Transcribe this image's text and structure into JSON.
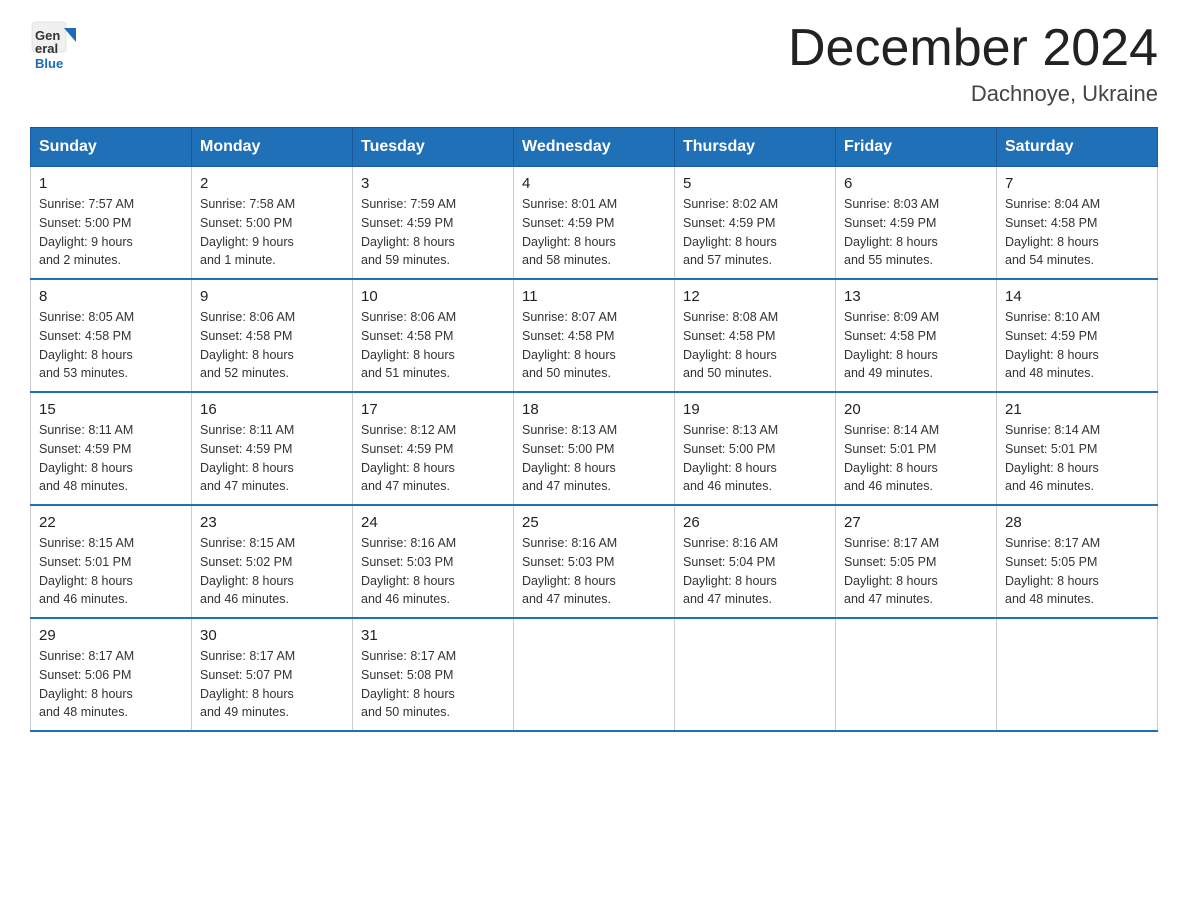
{
  "header": {
    "logo_general": "General",
    "logo_blue": "Blue",
    "month_title": "December 2024",
    "location": "Dachnoye, Ukraine"
  },
  "days_of_week": [
    "Sunday",
    "Monday",
    "Tuesday",
    "Wednesday",
    "Thursday",
    "Friday",
    "Saturday"
  ],
  "weeks": [
    [
      {
        "day": "1",
        "sunrise": "7:57 AM",
        "sunset": "5:00 PM",
        "daylight": "9 hours and 2 minutes."
      },
      {
        "day": "2",
        "sunrise": "7:58 AM",
        "sunset": "5:00 PM",
        "daylight": "9 hours and 1 minute."
      },
      {
        "day": "3",
        "sunrise": "7:59 AM",
        "sunset": "4:59 PM",
        "daylight": "8 hours and 59 minutes."
      },
      {
        "day": "4",
        "sunrise": "8:01 AM",
        "sunset": "4:59 PM",
        "daylight": "8 hours and 58 minutes."
      },
      {
        "day": "5",
        "sunrise": "8:02 AM",
        "sunset": "4:59 PM",
        "daylight": "8 hours and 57 minutes."
      },
      {
        "day": "6",
        "sunrise": "8:03 AM",
        "sunset": "4:59 PM",
        "daylight": "8 hours and 55 minutes."
      },
      {
        "day": "7",
        "sunrise": "8:04 AM",
        "sunset": "4:58 PM",
        "daylight": "8 hours and 54 minutes."
      }
    ],
    [
      {
        "day": "8",
        "sunrise": "8:05 AM",
        "sunset": "4:58 PM",
        "daylight": "8 hours and 53 minutes."
      },
      {
        "day": "9",
        "sunrise": "8:06 AM",
        "sunset": "4:58 PM",
        "daylight": "8 hours and 52 minutes."
      },
      {
        "day": "10",
        "sunrise": "8:06 AM",
        "sunset": "4:58 PM",
        "daylight": "8 hours and 51 minutes."
      },
      {
        "day": "11",
        "sunrise": "8:07 AM",
        "sunset": "4:58 PM",
        "daylight": "8 hours and 50 minutes."
      },
      {
        "day": "12",
        "sunrise": "8:08 AM",
        "sunset": "4:58 PM",
        "daylight": "8 hours and 50 minutes."
      },
      {
        "day": "13",
        "sunrise": "8:09 AM",
        "sunset": "4:58 PM",
        "daylight": "8 hours and 49 minutes."
      },
      {
        "day": "14",
        "sunrise": "8:10 AM",
        "sunset": "4:59 PM",
        "daylight": "8 hours and 48 minutes."
      }
    ],
    [
      {
        "day": "15",
        "sunrise": "8:11 AM",
        "sunset": "4:59 PM",
        "daylight": "8 hours and 48 minutes."
      },
      {
        "day": "16",
        "sunrise": "8:11 AM",
        "sunset": "4:59 PM",
        "daylight": "8 hours and 47 minutes."
      },
      {
        "day": "17",
        "sunrise": "8:12 AM",
        "sunset": "4:59 PM",
        "daylight": "8 hours and 47 minutes."
      },
      {
        "day": "18",
        "sunrise": "8:13 AM",
        "sunset": "5:00 PM",
        "daylight": "8 hours and 47 minutes."
      },
      {
        "day": "19",
        "sunrise": "8:13 AM",
        "sunset": "5:00 PM",
        "daylight": "8 hours and 46 minutes."
      },
      {
        "day": "20",
        "sunrise": "8:14 AM",
        "sunset": "5:01 PM",
        "daylight": "8 hours and 46 minutes."
      },
      {
        "day": "21",
        "sunrise": "8:14 AM",
        "sunset": "5:01 PM",
        "daylight": "8 hours and 46 minutes."
      }
    ],
    [
      {
        "day": "22",
        "sunrise": "8:15 AM",
        "sunset": "5:01 PM",
        "daylight": "8 hours and 46 minutes."
      },
      {
        "day": "23",
        "sunrise": "8:15 AM",
        "sunset": "5:02 PM",
        "daylight": "8 hours and 46 minutes."
      },
      {
        "day": "24",
        "sunrise": "8:16 AM",
        "sunset": "5:03 PM",
        "daylight": "8 hours and 46 minutes."
      },
      {
        "day": "25",
        "sunrise": "8:16 AM",
        "sunset": "5:03 PM",
        "daylight": "8 hours and 47 minutes."
      },
      {
        "day": "26",
        "sunrise": "8:16 AM",
        "sunset": "5:04 PM",
        "daylight": "8 hours and 47 minutes."
      },
      {
        "day": "27",
        "sunrise": "8:17 AM",
        "sunset": "5:05 PM",
        "daylight": "8 hours and 47 minutes."
      },
      {
        "day": "28",
        "sunrise": "8:17 AM",
        "sunset": "5:05 PM",
        "daylight": "8 hours and 48 minutes."
      }
    ],
    [
      {
        "day": "29",
        "sunrise": "8:17 AM",
        "sunset": "5:06 PM",
        "daylight": "8 hours and 48 minutes."
      },
      {
        "day": "30",
        "sunrise": "8:17 AM",
        "sunset": "5:07 PM",
        "daylight": "8 hours and 49 minutes."
      },
      {
        "day": "31",
        "sunrise": "8:17 AM",
        "sunset": "5:08 PM",
        "daylight": "8 hours and 50 minutes."
      },
      null,
      null,
      null,
      null
    ]
  ],
  "labels": {
    "sunrise": "Sunrise:",
    "sunset": "Sunset:",
    "daylight": "Daylight:"
  }
}
